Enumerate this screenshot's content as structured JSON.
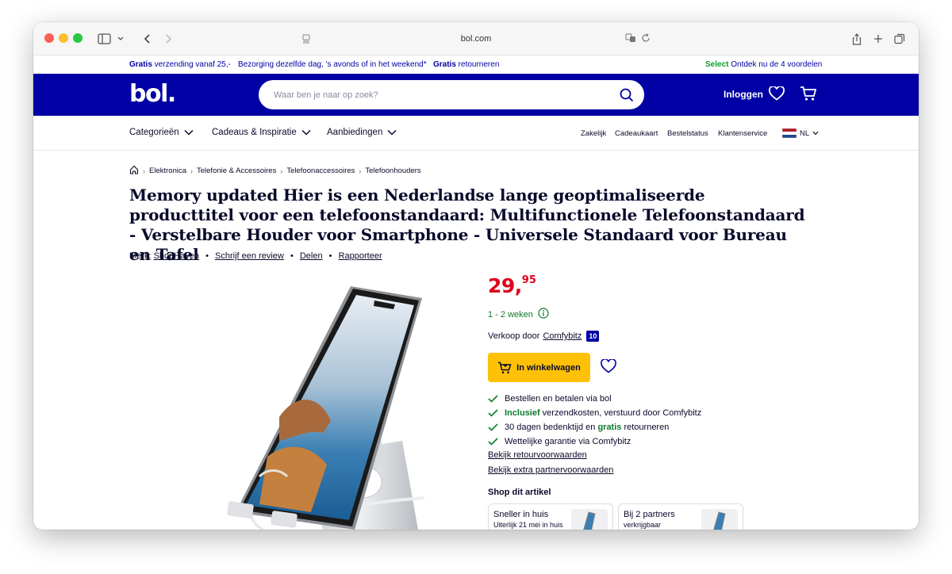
{
  "browser": {
    "url": "bol.com"
  },
  "promo": {
    "item1_bold": "Gratis",
    "item1_rest": " verzending vanaf 25,-",
    "item2": "Bezorging dezelfde dag, 's avonds of in het weekend*",
    "item3_bold": "Gratis",
    "item3_rest": " retourneren",
    "select_bold": "Select",
    "select_rest": " Ontdek nu de 4 voordelen"
  },
  "header": {
    "logo": "bol.",
    "search_placeholder": "Waar ben je naar op zoek?",
    "login": "Inloggen"
  },
  "nav": {
    "categories": [
      "Categorieën",
      "Cadeaus & Inspiratie",
      "Aanbiedingen"
    ],
    "right_links": [
      "Zakelijk",
      "Cadeaukaart",
      "Bestelstatus",
      "Klantenservice"
    ],
    "language": "NL"
  },
  "breadcrumbs": [
    "Elektronica",
    "Telefonie & Accessoires",
    "Telefoonaccessoires",
    "Telefoonhouders"
  ],
  "product": {
    "title": "Memory updated Hier is een Nederlandse lange geoptimaliseerde producttitel voor een telefoonstandaard: Multifunctionele Telefoonstandaard - Verstelbare Houder voor Smartphone - Universele Standaard voor Bureau en Tafel",
    "brand_label": "Merk:",
    "brand": "ShopHaven",
    "review_link": "Schrijf een review",
    "share_link": "Delen",
    "report_link": "Rapporteer",
    "price_main": "29,",
    "price_cents": "95",
    "delivery": "1 - 2 weken",
    "seller_label": "Verkoop door",
    "seller_name": "Comfybitz",
    "seller_score": "10",
    "cart_button": "In winkelwagen"
  },
  "usps": [
    {
      "bold": "",
      "text": "Bestellen en betalen via bol"
    },
    {
      "bold": "Inclusief",
      "text": " verzendkosten, verstuurd door Comfybitz"
    },
    {
      "pre": "30 dagen bedenktijd en ",
      "bold": "gratis",
      "text": " retourneren"
    },
    {
      "bold": "",
      "text": "Wettelijke garantie via Comfybitz"
    }
  ],
  "links": {
    "returns": "Bekijk retourvoorwaarden",
    "partner": "Bekijk extra partnervoorwaarden"
  },
  "shop": {
    "title": "Shop dit artikel",
    "cards": [
      {
        "title": "Sneller in huis",
        "subtitle": "Uiterlijk 21 mei in huis"
      },
      {
        "title": "Bij 2 partners",
        "subtitle": "verkrijgbaar"
      }
    ]
  },
  "colors": {
    "brand_blue": "#0000a4",
    "price_red": "#e0001b",
    "cart_yellow": "#ffc107",
    "success_green": "#0e7a2c"
  }
}
